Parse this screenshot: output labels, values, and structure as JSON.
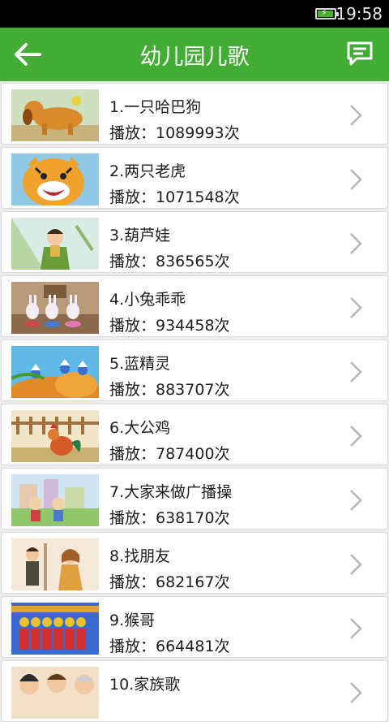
{
  "status_bar": {
    "time": "19:58",
    "battery_level": 0.95,
    "icons": [
      "battery-charging-icon"
    ]
  },
  "app_bar": {
    "title": "幼儿园儿歌",
    "back_icon": "back-arrow-icon",
    "message_icon": "message-icon"
  },
  "colors": {
    "primary": "#43ac35",
    "background": "#ebebeb",
    "card": "#ffffff",
    "text": "#1e1e1e",
    "chevron": "#b5b5b5"
  },
  "songs": [
    {
      "title": "1.一只哈巴狗",
      "plays": "播放：1089993次"
    },
    {
      "title": "2.两只老虎",
      "plays": "播放：1071548次"
    },
    {
      "title": "3.葫芦娃",
      "plays": "播放：836565次"
    },
    {
      "title": "4.小兔乖乖",
      "plays": "播放：934458次"
    },
    {
      "title": "5.蓝精灵",
      "plays": "播放：883707次"
    },
    {
      "title": "6.大公鸡",
      "plays": "播放：787400次"
    },
    {
      "title": "7.大家来做广播操",
      "plays": "播放：638170次"
    },
    {
      "title": "8.找朋友",
      "plays": "播放：682167次"
    },
    {
      "title": "9.猴哥",
      "plays": "播放：664481次"
    },
    {
      "title": "10.家族歌",
      "plays": ""
    }
  ]
}
